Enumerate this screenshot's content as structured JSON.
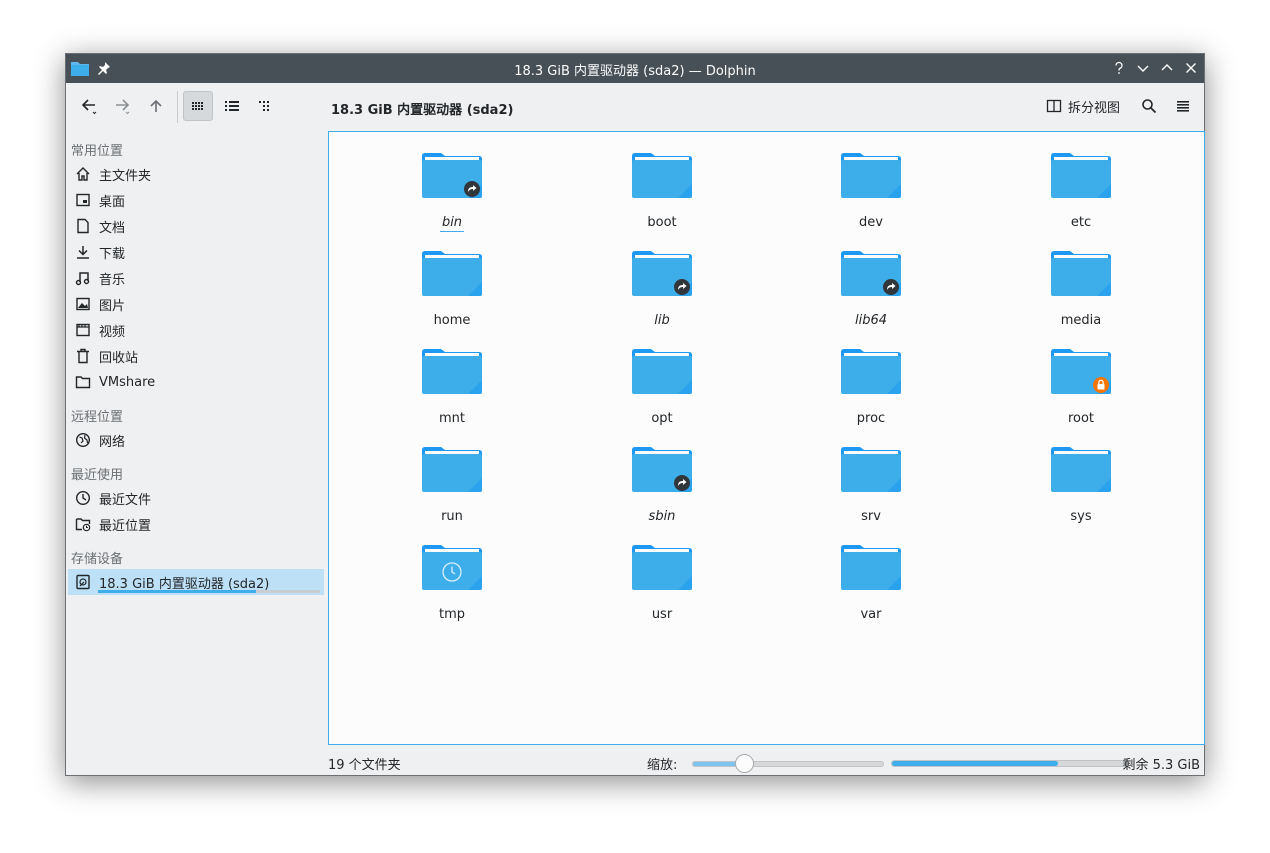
{
  "window": {
    "title": "18.3 GiB 内置驱动器 (sda2) — Dolphin"
  },
  "toolbar": {
    "location": "18.3 GiB 内置驱动器 (sda2)",
    "split_label": "拆分视图"
  },
  "sidebar": {
    "sections": [
      {
        "title": "常用位置",
        "items": [
          {
            "label": "主文件夹",
            "icon": "home-icon"
          },
          {
            "label": "桌面",
            "icon": "desktop-icon"
          },
          {
            "label": "文档",
            "icon": "document-icon"
          },
          {
            "label": "下载",
            "icon": "download-icon"
          },
          {
            "label": "音乐",
            "icon": "music-icon"
          },
          {
            "label": "图片",
            "icon": "image-icon"
          },
          {
            "label": "视频",
            "icon": "video-icon"
          },
          {
            "label": "回收站",
            "icon": "trash-icon"
          },
          {
            "label": "VMshare",
            "icon": "folder-icon"
          }
        ]
      },
      {
        "title": "远程位置",
        "items": [
          {
            "label": "网络",
            "icon": "network-icon"
          }
        ]
      },
      {
        "title": "最近使用",
        "items": [
          {
            "label": "最近文件",
            "icon": "recent-files-icon"
          },
          {
            "label": "最近位置",
            "icon": "recent-locations-icon"
          }
        ]
      },
      {
        "title": "存储设备",
        "items": [
          {
            "label": "18.3 GiB 内置驱动器 (sda2)",
            "icon": "drive-icon",
            "selected": true,
            "usage_fraction": 0.71
          }
        ]
      }
    ]
  },
  "files": [
    {
      "name": "bin",
      "emblem": "symlink",
      "italic": true,
      "focused": true
    },
    {
      "name": "boot"
    },
    {
      "name": "dev"
    },
    {
      "name": "etc"
    },
    {
      "name": "home"
    },
    {
      "name": "lib",
      "emblem": "symlink",
      "italic": true
    },
    {
      "name": "lib64",
      "emblem": "symlink",
      "italic": true
    },
    {
      "name": "media"
    },
    {
      "name": "mnt"
    },
    {
      "name": "opt"
    },
    {
      "name": "proc"
    },
    {
      "name": "root",
      "emblem": "locked"
    },
    {
      "name": "run"
    },
    {
      "name": "sbin",
      "emblem": "symlink",
      "italic": true
    },
    {
      "name": "srv"
    },
    {
      "name": "sys"
    },
    {
      "name": "tmp",
      "emblem": "clock"
    },
    {
      "name": "usr"
    },
    {
      "name": "var"
    }
  ],
  "statusbar": {
    "count_text": "19 个文件夹",
    "zoom_label": "缩放:",
    "zoom_fraction": 0.27,
    "space_text": "剩余 5.3 GiB",
    "space_used_fraction": 0.71
  },
  "colors": {
    "accent": "#3daee9",
    "folder": "#3daee9",
    "folder_dark": "#1d99f3",
    "titlebar": "#475057",
    "lock_emblem": "#f67400"
  }
}
